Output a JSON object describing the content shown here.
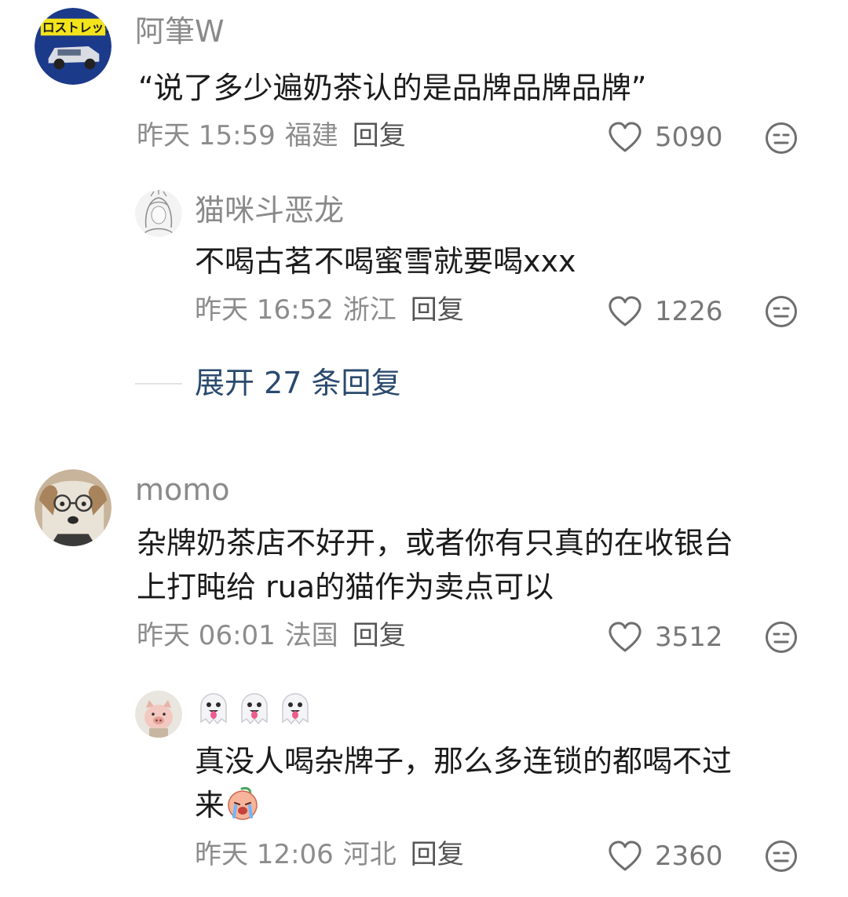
{
  "comments": [
    {
      "username": "阿筆W",
      "avatar": "car-avatar",
      "text": "“说了多少遍奶茶认的是品牌品牌品牌”",
      "time": "昨天 15:59",
      "location": "福建",
      "reply_label": "回复",
      "likes": "5090",
      "replies": [
        {
          "username": "猫咪斗恶龙",
          "avatar": "anime-sketch-avatar",
          "text": "不喝古茗不喝蜜雪就要喝xxx",
          "time": "昨天 16:52",
          "location": "浙江",
          "reply_label": "回复",
          "likes": "1226"
        }
      ],
      "expand_label": "展开 27 条回复"
    },
    {
      "username": "momo",
      "avatar": "dog-with-glasses-avatar",
      "text_line1": "杂牌奶茶店不好开，或者你有只真的在收银台",
      "text_line2": "上打盹给 rua的猫作为卖点可以",
      "time": "昨天 06:01",
      "location": "法国",
      "reply_label": "回复",
      "likes": "3512",
      "replies": [
        {
          "username_icons": [
            "ghost-tongue-emoji",
            "ghost-tongue-emoji",
            "ghost-tongue-emoji"
          ],
          "avatar": "pig-avatar",
          "text_line1": "真没人喝杂牌子，那么多连锁的都喝不过",
          "text_line2": "来",
          "text_line2_emoji": "crying-emoji",
          "time": "昨天 12:06",
          "location": "河北",
          "reply_label": "回复",
          "likes": "2360"
        }
      ]
    }
  ],
  "icons": {
    "like": "heart-outline-icon",
    "dislike": "meh-face-icon"
  },
  "colors": {
    "username": "#8a8a8a",
    "meta": "#8c8c8c",
    "expand": "#2a4a6e",
    "divider": "#e2e2e2"
  }
}
